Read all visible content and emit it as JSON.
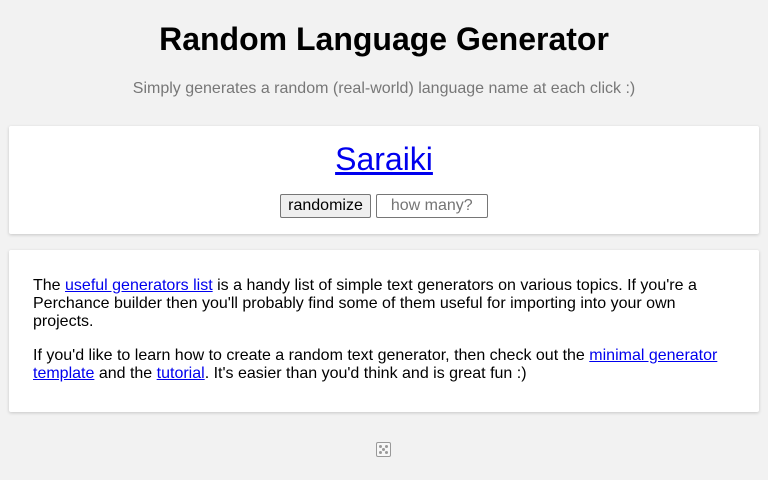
{
  "header": {
    "title": "Random Language Generator",
    "subtitle": "Simply generates a random (real-world) language name at each click :)"
  },
  "output": {
    "result": "Saraiki",
    "randomize_label": "randomize",
    "count_placeholder": "how many?"
  },
  "info": {
    "p1_prefix": "The ",
    "p1_link": "useful generators list",
    "p1_suffix": " is a handy list of simple text generators on various topics. If you're a Perchance builder then you'll probably find some of them useful for importing into your own projects.",
    "p2_prefix": "If you'd like to learn how to create a random text generator, then check out the ",
    "p2_link1": "minimal generator template",
    "p2_middle": " and the ",
    "p2_link2": "tutorial",
    "p2_suffix": ". It's easier than you'd think and is great fun :)"
  },
  "footer": {
    "icon": "dice-icon"
  },
  "colors": {
    "link": "#0000ee",
    "background": "#f2f2f2",
    "subtitle": "#777777"
  }
}
